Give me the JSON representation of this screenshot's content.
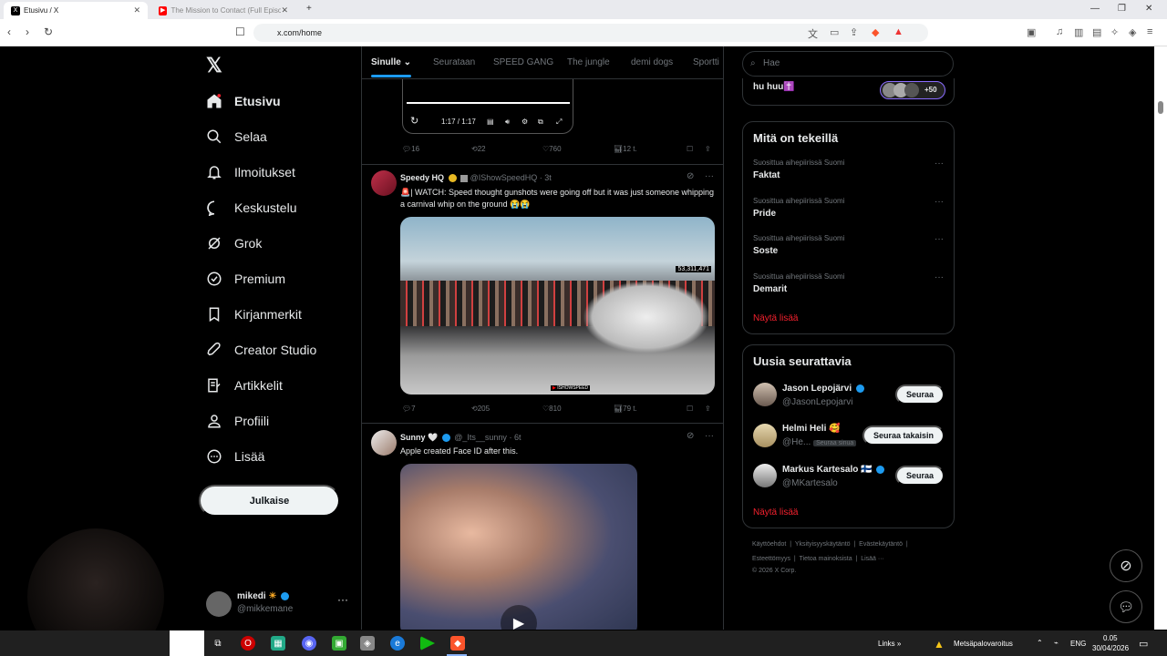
{
  "browser": {
    "tabs": [
      {
        "title": "Etusivu / X",
        "active": true
      },
      {
        "title": "The Mission to Contact (Full Episode...",
        "active": false
      }
    ],
    "url": "x.com/home"
  },
  "nav": {
    "items": [
      {
        "label": "Etusivu",
        "icon": "home-icon"
      },
      {
        "label": "Selaa",
        "icon": "search-icon"
      },
      {
        "label": "Ilmoitukset",
        "icon": "bell-icon"
      },
      {
        "label": "Keskustelu",
        "icon": "chat-icon"
      },
      {
        "label": "Grok",
        "icon": "grok-icon"
      },
      {
        "label": "Premium",
        "icon": "verified-icon"
      },
      {
        "label": "Kirjanmerkit",
        "icon": "bookmark-icon"
      },
      {
        "label": "Creator Studio",
        "icon": "rocket-icon"
      },
      {
        "label": "Artikkelit",
        "icon": "article-icon"
      },
      {
        "label": "Profiili",
        "icon": "person-icon"
      },
      {
        "label": "Lisää",
        "icon": "more-circle-icon"
      }
    ],
    "post_button": "Julkaise",
    "account": {
      "name": "mikedi",
      "handle": "@mikkemane"
    }
  },
  "feed": {
    "tabs": [
      "Sinulle",
      "Seurataan",
      "SPEED GANG",
      "The jungle",
      "demi dogs",
      "Sportti"
    ],
    "video_player": {
      "time": "1:17 / 1:17"
    },
    "first_actions": {
      "replies": "16",
      "reposts": "22",
      "likes": "760",
      "views": "12 t."
    },
    "tweets": [
      {
        "name": "Speedy HQ",
        "handle": "@IShowSpeedHQ",
        "time": "3t",
        "text": "🚨| WATCH: Speed thought gunshots were going off but it was just someone whipping a carnival whip on the ground 😭😭",
        "overlay": "53,311,471",
        "watermark": "ISHOWSPEED",
        "replies": "7",
        "reposts": "205",
        "likes": "810",
        "views": "79 t."
      },
      {
        "name": "Sunny 🤍",
        "handle": "@_Its__sunny",
        "time": "6t",
        "text": "Apple created Face ID after this."
      }
    ]
  },
  "right": {
    "search_placeholder": "Hae",
    "top_snippet": "hu huu✝️",
    "top_snippet_count": "+50",
    "trends_title": "Mitä on tekeillä",
    "trends": [
      {
        "context": "Suosittua aihepiirissä Suomi",
        "title": "Faktat"
      },
      {
        "context": "Suosittua aihepiirissä Suomi",
        "title": "Pride"
      },
      {
        "context": "Suosittua aihepiirissä Suomi",
        "title": "Soste"
      },
      {
        "context": "Suosittua aihepiirissä Suomi",
        "title": "Demarit"
      }
    ],
    "show_more": "Näytä lisää",
    "who_title": "Uusia seurattavia",
    "who": [
      {
        "name": "Jason Lepojärvi",
        "handle": "@JasonLepojarvi",
        "button": "Seuraa"
      },
      {
        "name": "Helmi Heli 🥰",
        "handle": "@He...",
        "badge": "Seuraa sinua",
        "button": "Seuraa takaisin"
      },
      {
        "name": "Markus Kartesalo 🇫🇮",
        "handle": "@MKartesalo",
        "button": "Seuraa"
      }
    ],
    "footer": {
      "line1": [
        "Käyttöehdot",
        "Yksityisyyskäytäntö",
        "Evästekäytäntö"
      ],
      "line2": [
        "Esteettömyys",
        "Tietoa mainoksista",
        "Lisää ···"
      ],
      "copyright": "© 2026 X Corp."
    }
  },
  "taskbar": {
    "links": "Links",
    "alert": "Metsäpalovaroitus",
    "lang": "ENG",
    "time": "0.05",
    "date": "30/04/2026"
  },
  "colors": {
    "accent": "#1d9bf0",
    "background": "#000000",
    "red_link": "#f4212e"
  }
}
